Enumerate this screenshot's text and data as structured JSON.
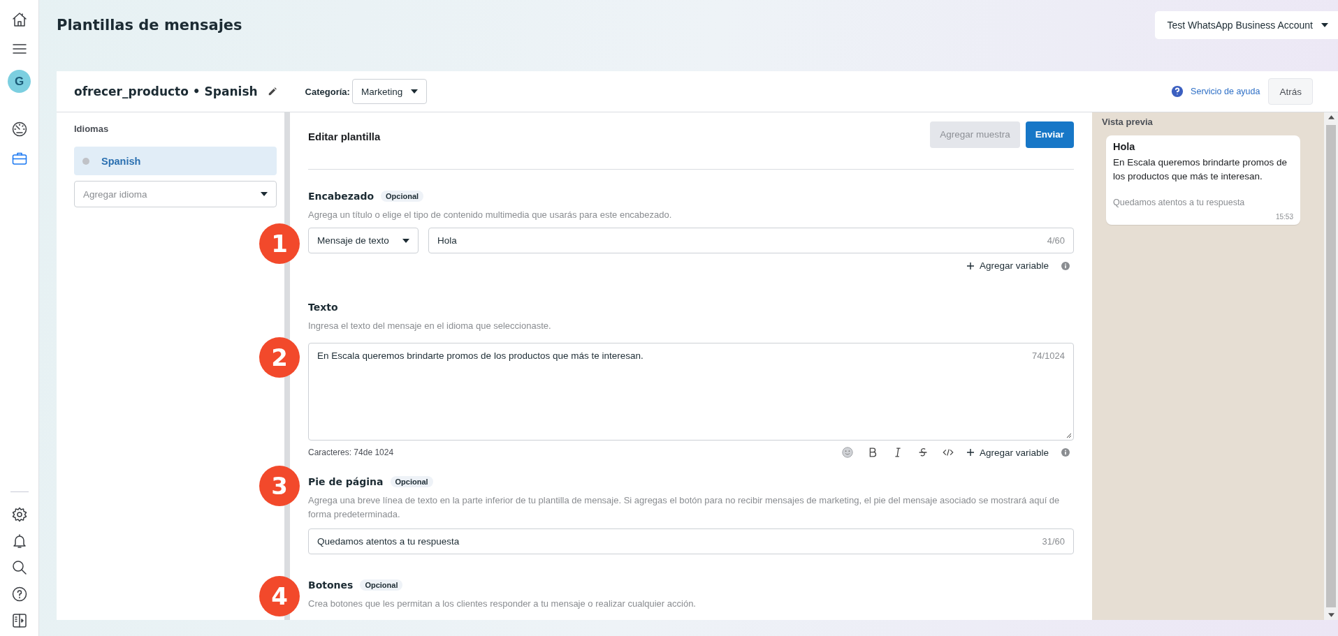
{
  "page_title": "Plantillas de mensajes",
  "account_selector": {
    "label": "Test WhatsApp Business Account"
  },
  "rail": {
    "avatar": "G",
    "items": [
      {
        "kind": "dashboard",
        "selected": false
      },
      {
        "kind": "tools",
        "selected": true
      }
    ]
  },
  "template": {
    "name": "ofrecer_producto • Spanish",
    "category_label": "Categoría:",
    "category": "Marketing"
  },
  "help_link": "Servicio de ayuda",
  "back_button": "Atrás",
  "languages": {
    "title": "Idiomas",
    "items": [
      {
        "label": "Spanish",
        "selected": true
      }
    ],
    "add_placeholder": "Agregar idioma"
  },
  "editor": {
    "title": "Editar plantilla",
    "buttons": [
      {
        "label": "Agregar muestra",
        "disabled": true
      },
      {
        "label": "Enviar",
        "disabled": false
      }
    ],
    "sections": [
      {
        "kind": "header",
        "marker": "1",
        "title": "Encabezado",
        "badge": "Opcional",
        "description": "Agrega un título o elige el tipo de contenido multimedia que usarás para este encabezado.",
        "type": "Mensaje de texto",
        "value": "Hola",
        "counter": "4/60",
        "add_variable": "Agregar variable"
      },
      {
        "kind": "body",
        "marker": "2",
        "title": "Texto",
        "description": "Ingresa el texto del mensaje en el idioma que seleccionaste.",
        "value": "En Escala queremos brindarte promos de los productos que más te interesan.",
        "counter": "74/1024",
        "char_count": "Caracteres: 74de 1024",
        "add_variable": "Agregar variable"
      },
      {
        "kind": "footer",
        "marker": "3",
        "title": "Pie de página",
        "badge": "Opcional",
        "description": "Agrega una breve línea de texto en la parte inferior de tu plantilla de mensaje. Si agregas el botón para no recibir mensajes de marketing, el pie del mensaje asociado se mostrará aquí de forma predeterminada.",
        "value": "Quedamos atentos a tu respuesta",
        "counter": "31/60"
      },
      {
        "kind": "buttons",
        "marker": "4",
        "title": "Botones",
        "badge": "Opcional",
        "description": "Crea botones que les permitan a los clientes responder a tu mensaje o realizar cualquier acción."
      }
    ]
  },
  "preview": {
    "title": "Vista previa",
    "header": "Hola",
    "body": "En Escala queremos brindarte promos de los productos que más te interesan.",
    "footer": "Quedamos atentos a tu respuesta",
    "time": "15:53"
  }
}
